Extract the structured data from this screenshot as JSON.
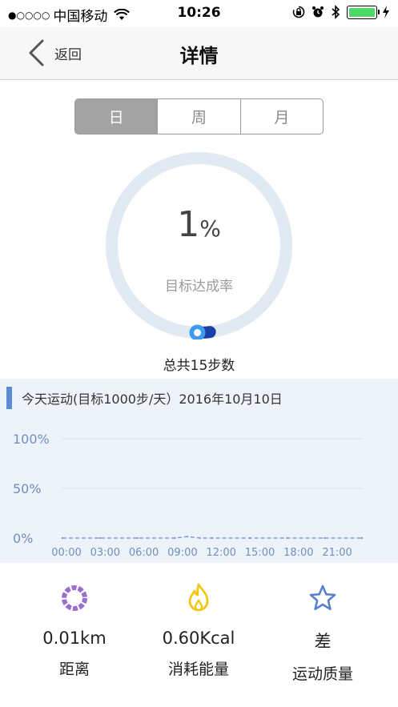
{
  "status_bar": {
    "signal": "●○○○○",
    "carrier": "中国移动",
    "time": "10:26"
  },
  "nav": {
    "back_label": "返回",
    "title": "详情"
  },
  "segments": [
    {
      "label": "日",
      "active": true
    },
    {
      "label": "周",
      "active": false
    },
    {
      "label": "月",
      "active": false
    }
  ],
  "ring": {
    "percent_value": "1",
    "percent_unit": "%",
    "progress_fraction": 0.01,
    "label": "目标达成率",
    "track_color": "#e1e9f2",
    "progress_color": "#1a3fa8",
    "dot_color": "#3e9bf0"
  },
  "total_steps": "总共15步数",
  "chart": {
    "header": "今天运动(目标1000步/天）2016年10月10日",
    "accent_color": "#5c8cd8"
  },
  "chart_data": {
    "type": "line",
    "title": "今天运动(目标1000步/天）2016年10月10日",
    "x_tick_labels": [
      "00:00",
      "03:00",
      "06:00",
      "09:00",
      "12:00",
      "15:00",
      "18:00",
      "21:00"
    ],
    "y_tick_labels": [
      "100%",
      "50%",
      "0%"
    ],
    "ylim": [
      0,
      100
    ],
    "grid": true,
    "series": [
      {
        "x": [
          "00:00",
          "03:00",
          "06:00",
          "09:00",
          "10:00",
          "11:00",
          "12:00",
          "15:00",
          "18:00",
          "21:00",
          "23:59"
        ],
        "values": [
          0,
          0,
          0,
          0,
          1.5,
          0,
          0,
          0,
          0,
          0,
          0
        ],
        "color": "#7b9fd6"
      }
    ]
  },
  "stats": [
    {
      "icon": "distance-ring-icon",
      "value": "0.01km",
      "label": "距离",
      "color": "#9b6fd0"
    },
    {
      "icon": "flame-icon",
      "value": "0.60Kcal",
      "label": "消耗能量",
      "color": "#f3c600"
    },
    {
      "icon": "star-icon",
      "value": "差",
      "label": "运动质量",
      "color": "#5b7fd1"
    }
  ]
}
